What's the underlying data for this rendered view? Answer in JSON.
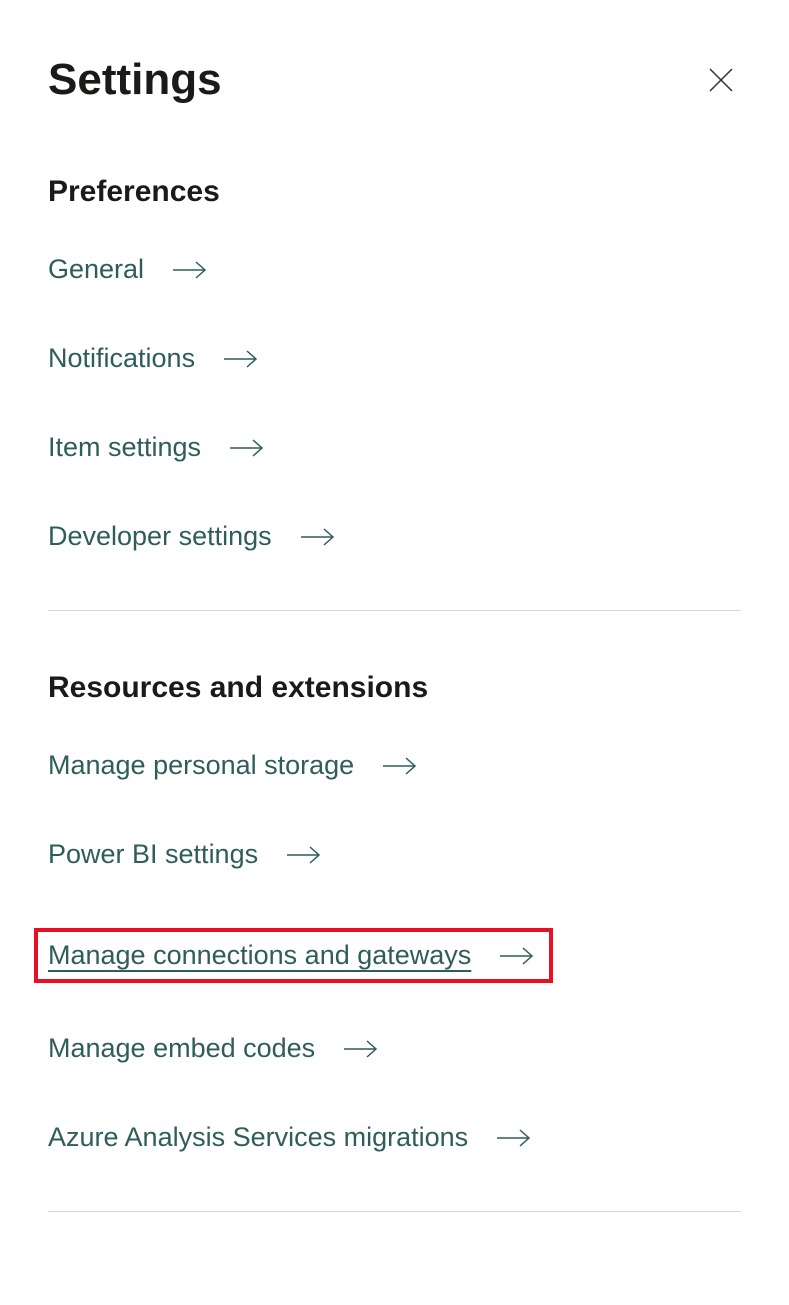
{
  "header": {
    "title": "Settings"
  },
  "sections": {
    "preferences": {
      "heading": "Preferences",
      "items": [
        {
          "label": "General"
        },
        {
          "label": "Notifications"
        },
        {
          "label": "Item settings"
        },
        {
          "label": "Developer settings"
        }
      ]
    },
    "resources": {
      "heading": "Resources and extensions",
      "items": [
        {
          "label": "Manage personal storage"
        },
        {
          "label": "Power BI settings"
        },
        {
          "label": "Manage connections and gateways"
        },
        {
          "label": "Manage embed codes"
        },
        {
          "label": "Azure Analysis Services migrations"
        }
      ]
    }
  }
}
